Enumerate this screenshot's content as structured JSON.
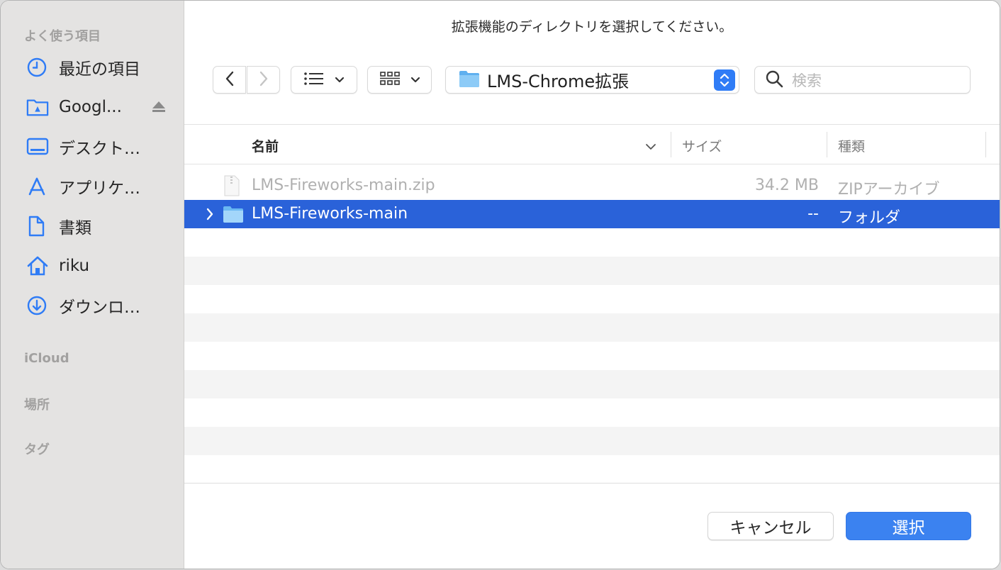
{
  "dialog": {
    "title": "拡張機能のディレクトリを選択してください。"
  },
  "sidebar": {
    "favorites_header": "よく使う項目",
    "items": [
      {
        "label": "最近の項目",
        "icon": "clock-icon"
      },
      {
        "label": "Googl...",
        "icon": "google-drive-folder-icon"
      },
      {
        "label": "デスクト…",
        "icon": "desktop-icon"
      },
      {
        "label": "アプリケ…",
        "icon": "applications-icon"
      },
      {
        "label": "書類",
        "icon": "document-icon"
      },
      {
        "label": "riku",
        "icon": "home-icon"
      },
      {
        "label": "ダウンロ…",
        "icon": "download-icon"
      }
    ],
    "icloud_header": "iCloud",
    "locations_header": "場所",
    "tags_header": "タグ"
  },
  "toolbar": {
    "path_label": "LMS-Chrome拡張",
    "search_placeholder": "検索"
  },
  "table": {
    "columns": [
      "名前",
      "サイズ",
      "種類"
    ],
    "rows": [
      {
        "name": "LMS-Fireworks-main.zip",
        "size": "34.2 MB",
        "kind": "ZIPアーカイブ",
        "selected": false
      },
      {
        "name": "LMS-Fireworks-main",
        "size": "--",
        "kind": "フォルダ",
        "selected": true
      }
    ]
  },
  "buttons": {
    "cancel": "キャンセル",
    "select": "選択"
  },
  "colors": {
    "accent": "#2a62d9",
    "primary_button": "#3b82f0",
    "icon_blue": "#2f7cf6"
  }
}
